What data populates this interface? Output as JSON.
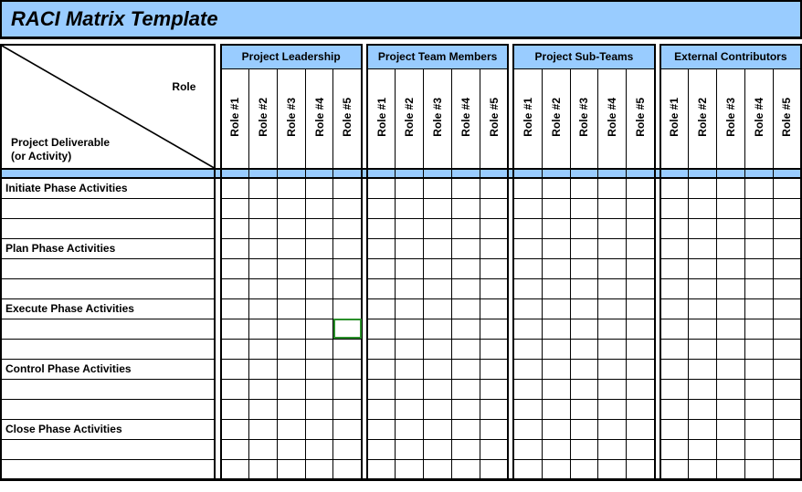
{
  "title": "RACI Matrix Template",
  "corner": {
    "role_label": "Role",
    "deliverable_label_line1": "Project Deliverable",
    "deliverable_label_line2": "(or Activity)"
  },
  "groups": [
    {
      "name": "Project Leadership",
      "roles": [
        "Role #1",
        "Role #2",
        "Role #3",
        "Role #4",
        "Role #5"
      ]
    },
    {
      "name": "Project Team Members",
      "roles": [
        "Role #1",
        "Role #2",
        "Role #3",
        "Role #4",
        "Role #5"
      ]
    },
    {
      "name": "Project Sub-Teams",
      "roles": [
        "Role #1",
        "Role #2",
        "Role #3",
        "Role #4",
        "Role #5"
      ]
    },
    {
      "name": "External Contributors",
      "roles": [
        "Role #1",
        "Role #2",
        "Role #3",
        "Role #4",
        "Role #5"
      ]
    }
  ],
  "phases": [
    "Initiate Phase Activities",
    "Plan Phase Activities",
    "Execute Phase Activities",
    "Control Phase Activities",
    "Close Phase Activities"
  ],
  "rows_per_phase": 3,
  "selected_cell": {
    "phase_index": 2,
    "row_in_phase": 1,
    "group_index": 0,
    "role_index": 4
  }
}
